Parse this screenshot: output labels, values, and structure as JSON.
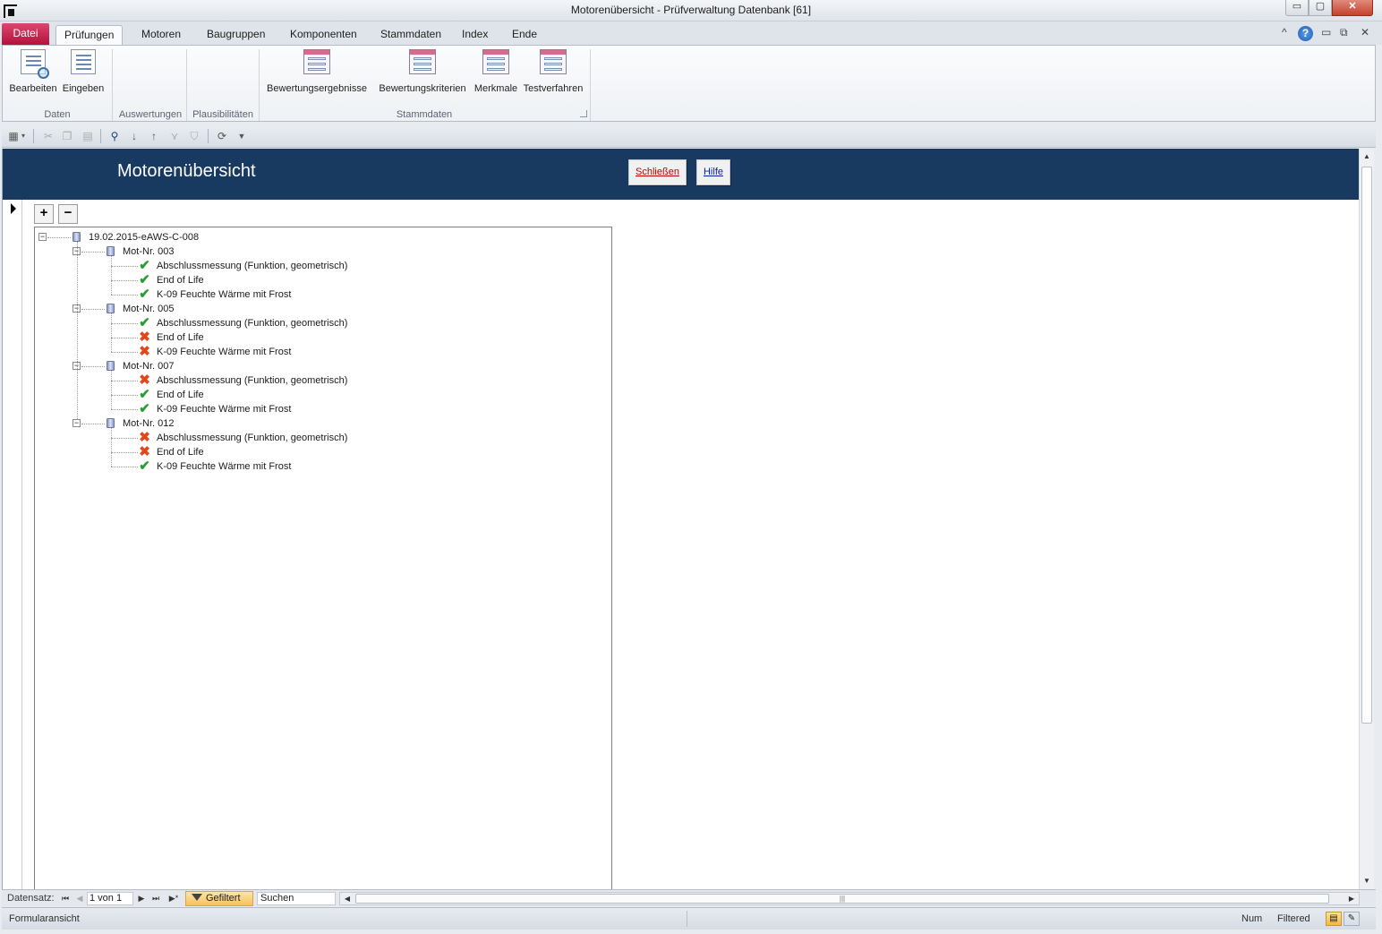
{
  "window": {
    "title": "Motorenübersicht  -  Prüfverwaltung Datenbank [61]",
    "min_glyph": "▭",
    "max_glyph": "▢",
    "close_glyph": "✕"
  },
  "ribbon": {
    "tabs": [
      "Datei",
      "Prüfungen",
      "Motoren",
      "Baugruppen",
      "Komponenten",
      "Stammdaten",
      "Index",
      "Ende"
    ],
    "active_tab": "Prüfungen",
    "right_icons": [
      "collapse-ribbon-icon",
      "help-icon",
      "minimize-icon",
      "restore-icon",
      "close-icon"
    ],
    "right_glyphs": {
      "collapse": "^",
      "help": "?",
      "minimize": "▭",
      "restore": "⧉",
      "close": "✕"
    },
    "groups": [
      {
        "label": "Daten",
        "buttons": [
          "Bearbeiten",
          "Eingeben"
        ]
      },
      {
        "label": "Auswertungen",
        "buttons": []
      },
      {
        "label": "Plausibilitäten",
        "buttons": []
      },
      {
        "label": "Stammdaten",
        "buttons": [
          "Bewertungsergebnisse",
          "Bewertungskriterien",
          "Merkmale",
          "Testverfahren"
        ]
      }
    ]
  },
  "quick_toolbar": {
    "icons": [
      "view-icon",
      "dropdown-icon",
      "cut-icon",
      "copy-icon",
      "paste-icon",
      "find-icon",
      "sort-ascending-icon",
      "sort-descending-icon",
      "filter-selection-icon",
      "filter-icon",
      "refresh-icon",
      "customize-icon"
    ]
  },
  "form": {
    "title": "Motorenübersicht",
    "close_button": "Schließen",
    "help_button": "Hilfe",
    "expand_all": "+",
    "collapse_all": "−",
    "expander_glyph": "−",
    "tree": {
      "root": "19.02.2015-eAWS-C-008",
      "motors": [
        {
          "name": "Mot-Nr. 003",
          "tests": [
            {
              "name": "Abschlussmessung (Funktion, geometrisch)",
              "status": "ok"
            },
            {
              "name": "End of Life",
              "status": "ok"
            },
            {
              "name": "K-09 Feuchte Wärme mit Frost",
              "status": "ok"
            }
          ]
        },
        {
          "name": "Mot-Nr. 005",
          "tests": [
            {
              "name": "Abschlussmessung (Funktion, geometrisch)",
              "status": "ok"
            },
            {
              "name": "End of Life",
              "status": "fail"
            },
            {
              "name": "K-09 Feuchte Wärme mit Frost",
              "status": "fail"
            }
          ]
        },
        {
          "name": "Mot-Nr. 007",
          "tests": [
            {
              "name": "Abschlussmessung (Funktion, geometrisch)",
              "status": "fail"
            },
            {
              "name": "End of Life",
              "status": "ok"
            },
            {
              "name": "K-09 Feuchte Wärme mit Frost",
              "status": "ok"
            }
          ]
        },
        {
          "name": "Mot-Nr. 012",
          "tests": [
            {
              "name": "Abschlussmessung (Funktion, geometrisch)",
              "status": "fail"
            },
            {
              "name": "End of Life",
              "status": "fail"
            },
            {
              "name": "K-09 Feuchte Wärme mit Frost",
              "status": "ok"
            }
          ]
        }
      ]
    },
    "status_glyphs": {
      "ok": "✔",
      "fail": "✖"
    },
    "status_colors": {
      "ok": "#2e9c2e",
      "fail": "#dd4a1f"
    }
  },
  "navigation": {
    "label": "Datensatz:",
    "position": "1 von 1",
    "filter_label": "Gefiltert",
    "search_placeholder": "Suchen",
    "buttons": {
      "first": "⏮",
      "prev": "◀",
      "next": "▶",
      "last": "⏭",
      "new": "▶*"
    },
    "scroll": {
      "left": "◀",
      "right": "▶",
      "grip": "|||"
    }
  },
  "statusbar": {
    "left": "Formularansicht",
    "num": "Num",
    "filtered": "Filtered",
    "form_view_icon": "▤",
    "design_view_icon": "✎"
  },
  "colors": {
    "header_bg": "#183a61",
    "file_tab": "#c0194a",
    "close_text": "#c00000",
    "help_text": "#0a1ba8"
  }
}
